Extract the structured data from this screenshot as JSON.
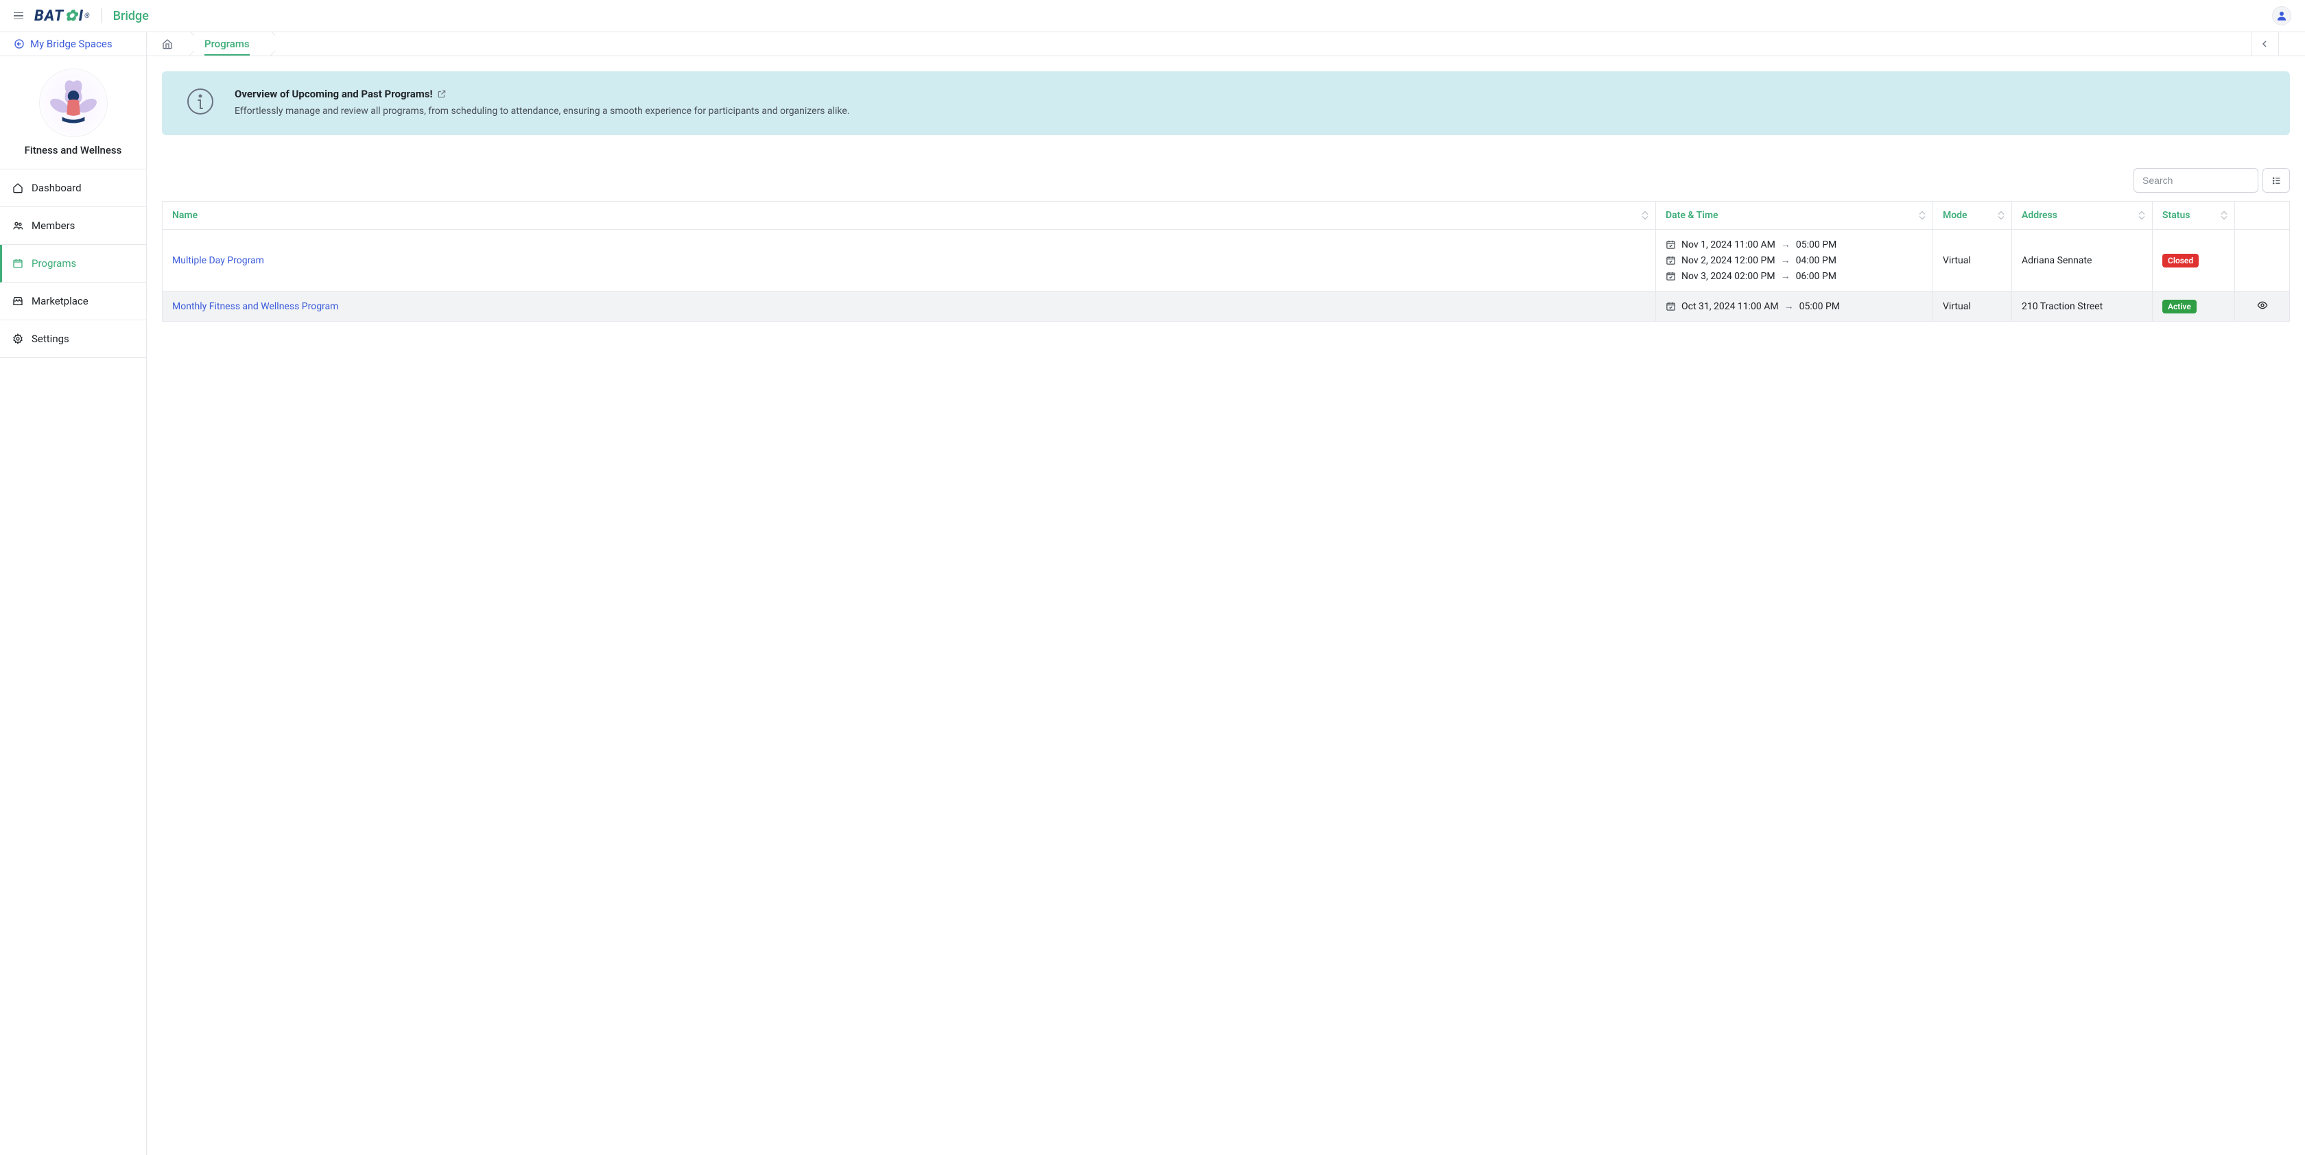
{
  "header": {
    "brand_main": "BAT",
    "brand_sub": "Bridge"
  },
  "secondbar": {
    "back_label": "My Bridge Spaces",
    "crumb_programs": "Programs"
  },
  "sidebar": {
    "space_name": "Fitness and Wellness",
    "items": {
      "dashboard": "Dashboard",
      "members": "Members",
      "programs": "Programs",
      "marketplace": "Marketplace",
      "settings": "Settings"
    }
  },
  "infobox": {
    "title": "Overview of Upcoming and Past Programs!",
    "desc": "Effortlessly manage and review all programs, from scheduling to attendance, ensuring a smooth experience for participants and organizers alike."
  },
  "toolbar": {
    "search_placeholder": "Search"
  },
  "table": {
    "headers": {
      "name": "Name",
      "datetime": "Date & Time",
      "mode": "Mode",
      "address": "Address",
      "status": "Status"
    },
    "rows": [
      {
        "name": "Multiple Day Program",
        "sessions": [
          {
            "date": "Nov 1, 2024 11:00 AM",
            "end": "05:00 PM"
          },
          {
            "date": "Nov 2, 2024 12:00 PM",
            "end": "04:00 PM"
          },
          {
            "date": "Nov 3, 2024 02:00 PM",
            "end": "06:00 PM"
          }
        ],
        "mode": "Virtual",
        "address": "Adriana Sennate",
        "status": "Closed",
        "status_class": "closed",
        "show_eye": false
      },
      {
        "name": "Monthly Fitness and Wellness Program",
        "sessions": [
          {
            "date": "Oct 31, 2024 11:00 AM",
            "end": "05:00 PM"
          }
        ],
        "mode": "Virtual",
        "address": "210 Traction Street",
        "status": "Active",
        "status_class": "active",
        "show_eye": true
      }
    ]
  }
}
